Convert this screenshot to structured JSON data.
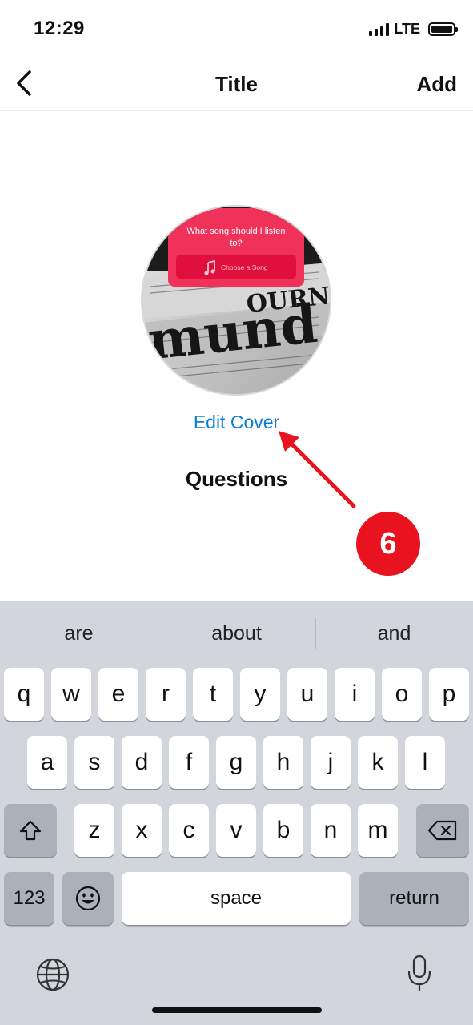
{
  "status_bar": {
    "time": "12:29",
    "network": "LTE"
  },
  "nav": {
    "title": "Title",
    "add_label": "Add"
  },
  "cover": {
    "sticker_question": "What song should I listen to?",
    "sticker_button": "Choose a Song"
  },
  "edit_cover_label": "Edit Cover",
  "questions_label": "Questions",
  "annotation": {
    "step": "6",
    "color": "#e8131f"
  },
  "keyboard": {
    "suggestions": [
      "are",
      "about",
      "and"
    ],
    "row1": [
      "q",
      "w",
      "e",
      "r",
      "t",
      "y",
      "u",
      "i",
      "o",
      "p"
    ],
    "row2": [
      "a",
      "s",
      "d",
      "f",
      "g",
      "h",
      "j",
      "k",
      "l"
    ],
    "row3": [
      "z",
      "x",
      "c",
      "v",
      "b",
      "n",
      "m"
    ],
    "numbers_label": "123",
    "space_label": "space",
    "return_label": "return"
  },
  "icons": [
    "back-chevron-icon",
    "signal-icon",
    "battery-icon",
    "music-note-icon",
    "shift-icon",
    "backspace-icon",
    "emoji-icon",
    "globe-icon",
    "microphone-icon"
  ],
  "colors": {
    "link": "#0a7fd1",
    "sticker_pink": "#f0325a",
    "keyboard_bg": "#d2d5db"
  }
}
